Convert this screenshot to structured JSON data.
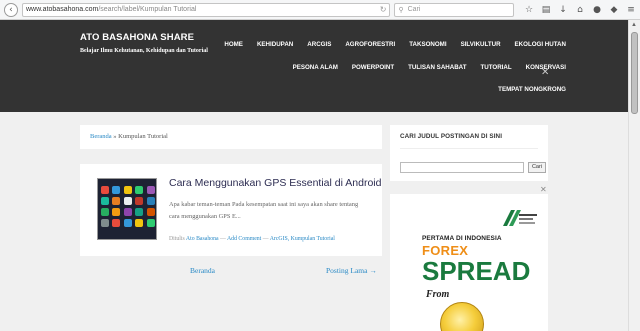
{
  "browser": {
    "url_host": "www.atobasahona.com",
    "url_path": "/search/label/Kumpulan Tutorial",
    "search_placeholder": "Cari"
  },
  "site": {
    "title": "ATO BASAHONA SHARE",
    "description": "Belajar Ilmu Kehutanan, Kehidupan dan Tutorial"
  },
  "menu": {
    "row1": [
      "HOME",
      "KEHIDUPAN",
      "ARCGIS",
      "AGROFORESTRI",
      "TAKSONOMI",
      "SILVIKULTUR",
      "EKOLOGI HUTAN"
    ],
    "row2": [
      "PESONA ALAM",
      "POWERPOINT",
      "TULISAN SAHABAT",
      "TUTORIAL",
      "KONSERVASI"
    ],
    "row3": [
      "TEMPAT NONGKRONG"
    ]
  },
  "breadcrumb": {
    "home": "Beranda",
    "separator": " » ",
    "current": "Kumpulan Tutorial"
  },
  "post": {
    "title": "Cara Menggunakan GPS Essential di Android",
    "excerpt": "Apa kabar teman-teman    Pada kesempatan saat ini saya akan share tentang cara menggunakan GPS E...",
    "meta_prefix": "Ditulis ",
    "author": "Ato Basahona",
    "sep1": " — ",
    "comments": "Add Comment",
    "sep2": " — ",
    "labels": "ArcGIS, Kumpulan Tutorial"
  },
  "pager": {
    "home": "Beranda",
    "older": "Posting Lama →"
  },
  "sidebar": {
    "search_title": "CARI JUDUL POSTINGAN DI SINI",
    "search_button": "Cari"
  },
  "ad": {
    "line1": "PERTAMA DI INDONESIA",
    "forex": "FOREX",
    "spread": "SPREAD",
    "from": "From"
  },
  "colors": {
    "header_bg": "#333333",
    "link": "#2a8ac6",
    "ad_green": "#1a7a3e",
    "ad_orange": "#ef8e17"
  }
}
